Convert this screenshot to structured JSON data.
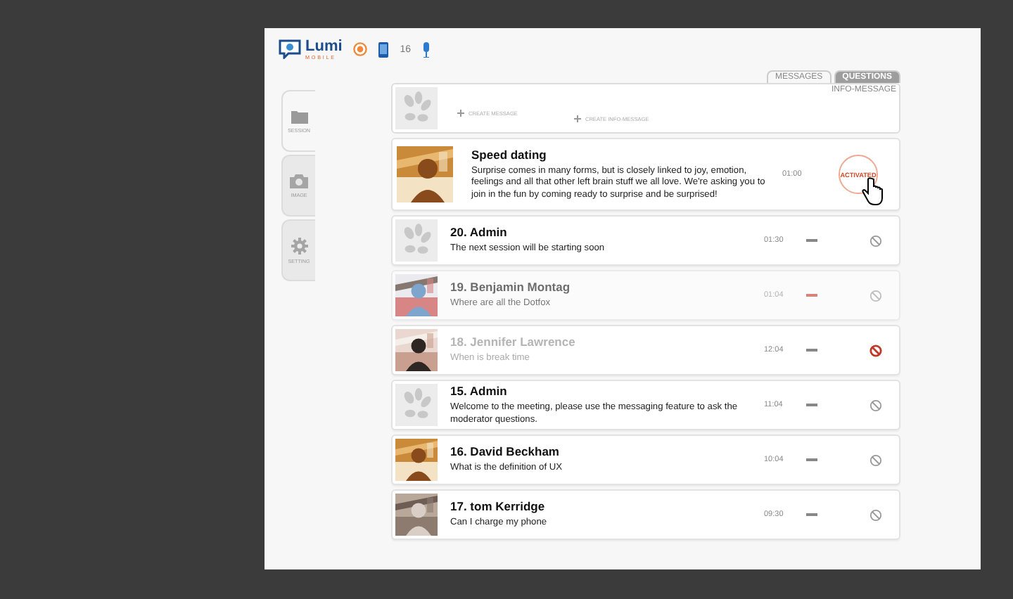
{
  "header": {
    "logo": "Lumi",
    "logo_sub": "MOBILE",
    "count": "16"
  },
  "sidebar": {
    "items": [
      {
        "label": "SESSION",
        "selected": true
      },
      {
        "label": "IMAGE",
        "selected": false
      },
      {
        "label": "SETTING",
        "selected": false
      }
    ]
  },
  "tabs": [
    {
      "label": "MESSAGES",
      "selected": false
    },
    {
      "label": "QUESTIONS",
      "selected": true
    }
  ],
  "subtab": "INFO-MESSAGE",
  "create": [
    "CREATE MESSAGE",
    "CREATE INFO-MESSAGE"
  ],
  "rows": [
    {
      "kind": "featured",
      "title": "Speed dating",
      "text": "Surprise comes in many forms, but is closely linked to joy, emotion, feelings and all that other left brain stuff we all love. We're asking you to join in the fun by coming ready to surprise and be surprised!",
      "time": "01:00",
      "status": "ACTIVATED"
    },
    {
      "kind": "admin",
      "title": "20. Admin",
      "text": "The next session will be starting soon",
      "time": "01:30",
      "moderated": false,
      "banned": false
    },
    {
      "kind": "person",
      "title": "19. Benjamin Montag",
      "text": "Where are all the Dotfox",
      "time": "01:04",
      "moderated": true,
      "banned": false
    },
    {
      "kind": "person",
      "title": "18. Jennifer Lawrence",
      "text": "When is break time",
      "time": "12:04",
      "moderated": false,
      "banned": true
    },
    {
      "kind": "admin",
      "title": "15. Admin",
      "text": "Welcome to the meeting, please use the messaging feature to ask the moderator questions.",
      "time": "11:04",
      "moderated": false,
      "banned": false
    },
    {
      "kind": "person",
      "title": "16. David Beckham",
      "text": "What is the definition of UX",
      "time": "10:04",
      "moderated": false,
      "banned": false
    },
    {
      "kind": "person",
      "title": "17. tom Kerridge",
      "text": "Can I charge my phone",
      "time": "09:30",
      "moderated": false,
      "banned": false
    }
  ]
}
